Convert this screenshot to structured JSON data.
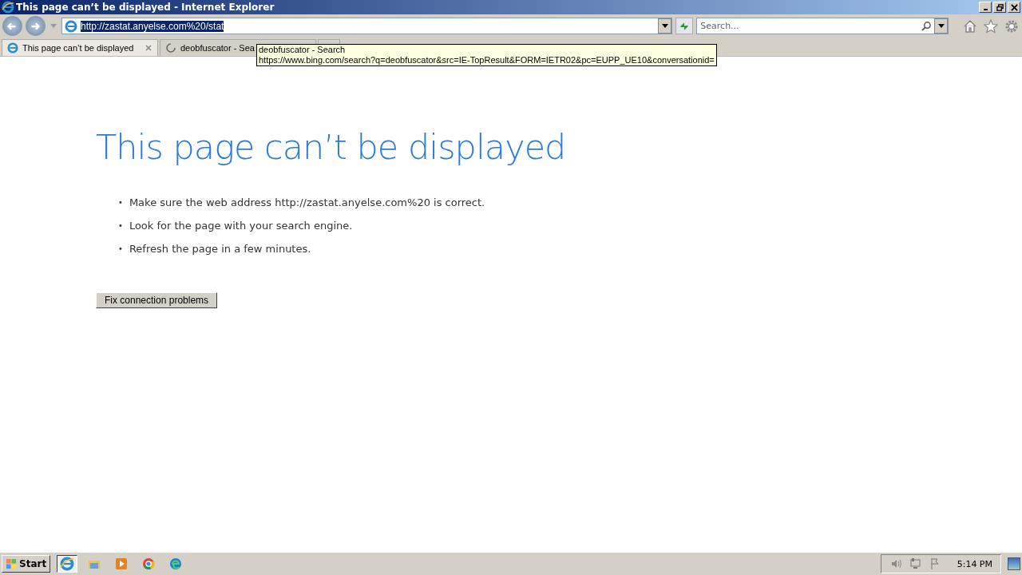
{
  "window": {
    "title": "This page can’t be displayed - Internet Explorer"
  },
  "address_bar": {
    "value": "http://zastat.anyelse.com%20/stat"
  },
  "search": {
    "placeholder": "Search..."
  },
  "tabs": [
    {
      "label": "This page can’t be displayed",
      "selected": true,
      "loading": false
    },
    {
      "label": "deobfuscator - Sea",
      "selected": false,
      "loading": true
    }
  ],
  "tooltip": {
    "title": "deobfuscator - Search",
    "url": "https://www.bing.com/search?q=deobfuscator&src=IE-TopResult&FORM=IETR02&pc=EUPP_UE10&conversationid="
  },
  "page": {
    "heading": "This page can’t be displayed",
    "bullets": [
      {
        "marker": "•",
        "text": "Make sure the web address http://zastat.anyelse.com%20 is correct."
      },
      {
        "marker": "•",
        "text": "Look for the page with your search engine."
      },
      {
        "marker": "•",
        "text": "Refresh the page in a few minutes."
      }
    ],
    "button": "Fix connection problems"
  },
  "taskbar": {
    "start": "Start",
    "clock": "5:14 PM"
  }
}
